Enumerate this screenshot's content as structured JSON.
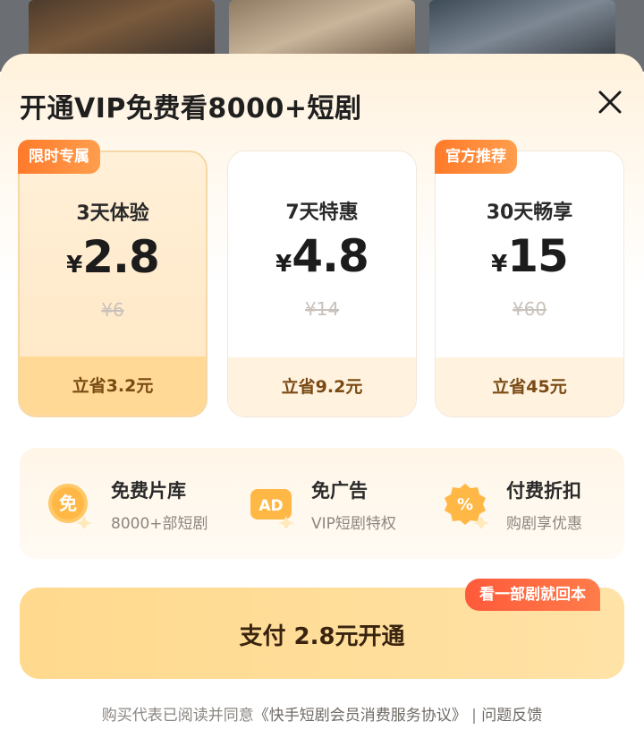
{
  "sheet": {
    "title": "开通VIP免费看8000+短剧",
    "close_icon": "close-icon"
  },
  "plans": [
    {
      "badge": "限时专属",
      "name": "3天体验",
      "currency": "¥",
      "price": "2.8",
      "original": "¥6",
      "save": "立省3.2元",
      "selected": true
    },
    {
      "badge": "",
      "name": "7天特惠",
      "currency": "¥",
      "price": "4.8",
      "original": "¥14",
      "save": "立省9.2元",
      "selected": false
    },
    {
      "badge": "官方推荐",
      "name": "30天畅享",
      "currency": "¥",
      "price": "15",
      "original": "¥60",
      "save": "立省45元",
      "selected": false
    }
  ],
  "benefits": [
    {
      "icon": "free-icon",
      "icon_text": "免",
      "title": "免费片库",
      "sub": "8000+部短剧"
    },
    {
      "icon": "ad-icon",
      "icon_text": "AD",
      "title": "免广告",
      "sub": "VIP短剧特权"
    },
    {
      "icon": "discount-icon",
      "icon_text": "%",
      "title": "付费折扣",
      "sub": "购剧享优惠"
    }
  ],
  "pay": {
    "label": "支付 2.8元开通",
    "tag": "看一部剧就回本"
  },
  "footer": {
    "prefix": "购买代表已阅读并同意",
    "agreement": "《快手短剧会员消费服务协议》",
    "separator": "|",
    "feedback": "问题反馈"
  },
  "colors": {
    "accent": "#ff7a2a",
    "selected_bg": "#ffe7c3",
    "pay_button": "#ffd98d"
  }
}
